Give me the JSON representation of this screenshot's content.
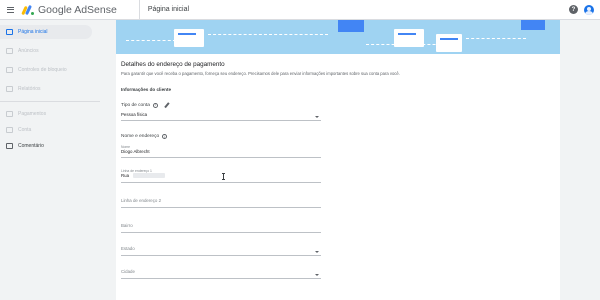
{
  "topbar": {
    "app_title": "Google AdSense",
    "page_title": "Página inicial",
    "help_symbol": "?"
  },
  "sidebar": {
    "items": [
      {
        "label": "Página inicial",
        "icon": "home-icon",
        "active": true
      },
      {
        "label": "Anúncios",
        "icon": "ads-icon",
        "active": false
      },
      {
        "label": "Controles de bloqueio",
        "icon": "block-icon",
        "active": false
      },
      {
        "label": "Relatórios",
        "icon": "reports-icon",
        "active": false
      },
      {
        "label": "Pagamentos",
        "icon": "payments-icon",
        "active": false
      },
      {
        "label": "Conta",
        "icon": "account-icon",
        "active": false
      },
      {
        "label": "Comentário",
        "icon": "feedback-icon",
        "active": false
      }
    ]
  },
  "main": {
    "title": "Detalhes do endereço de pagamento",
    "description": "Para garantir que você receba o pagamento, forneça seu endereço. Precisamos dele para enviar informações importantes sobre sua conta para você.",
    "section_title": "Informações do cliente",
    "account_type": {
      "label": "Tipo de conta",
      "value": "Pessoa física"
    },
    "name_address": {
      "label": "Nome e endereço"
    },
    "fields": {
      "name": {
        "label": "Nome",
        "value": "Diogo Albrecht"
      },
      "address1": {
        "label": "Linha de endereço 1",
        "value": "Rua"
      },
      "address2": {
        "placeholder": "Linha de endereço 2"
      },
      "neighborhood": {
        "placeholder": "Bairro"
      },
      "state": {
        "placeholder": "Estado"
      },
      "city": {
        "placeholder": "Cidade"
      }
    }
  },
  "colors": {
    "banner": "#9fd3f2",
    "accent": "#1a73e8"
  }
}
